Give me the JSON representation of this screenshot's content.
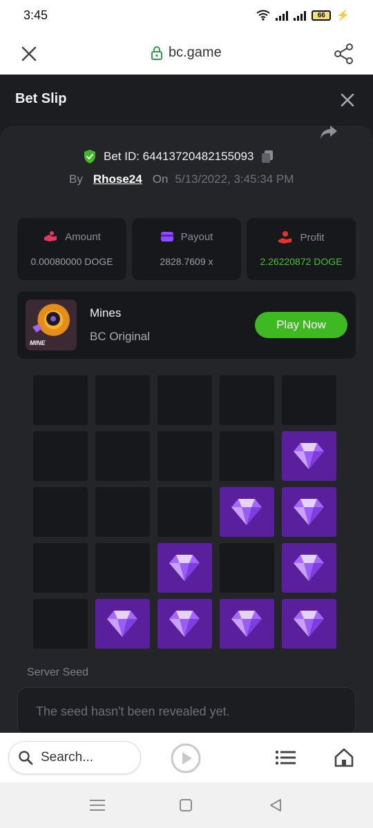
{
  "status_bar": {
    "time": "3:45",
    "battery": "66"
  },
  "browser": {
    "url": "bc.game",
    "search_placeholder": "Search..."
  },
  "bet_slip": {
    "title": "Bet Slip",
    "bet_id_label": "Bet ID: 64413720482155093",
    "by_label": "By",
    "username": "Rhose24",
    "on_label": "On",
    "date": "5/13/2022, 3:45:34 PM",
    "stats": [
      {
        "label": "Amount",
        "value": "0.00080000 DOGE"
      },
      {
        "label": "Payout",
        "value": "2828.7609 x"
      },
      {
        "label": "Profit",
        "value": "2.26220872 DOGE"
      }
    ],
    "game": {
      "thumb_label": "MINE",
      "name": "Mines",
      "subtitle": "BC Original",
      "play_label": "Play Now"
    },
    "grid": [
      [
        0,
        0,
        0,
        0,
        0
      ],
      [
        0,
        0,
        0,
        0,
        1
      ],
      [
        0,
        0,
        0,
        1,
        1
      ],
      [
        0,
        0,
        1,
        0,
        1
      ],
      [
        0,
        1,
        1,
        1,
        1
      ]
    ],
    "server_seed_label": "Server Seed",
    "server_seed_value": "The seed hasn't been revealed yet."
  },
  "colors": {
    "accent_green": "#3fb922",
    "profit_green": "#48c02e",
    "gem_tile": "#5a1f9c",
    "background": "#1c1d21"
  }
}
